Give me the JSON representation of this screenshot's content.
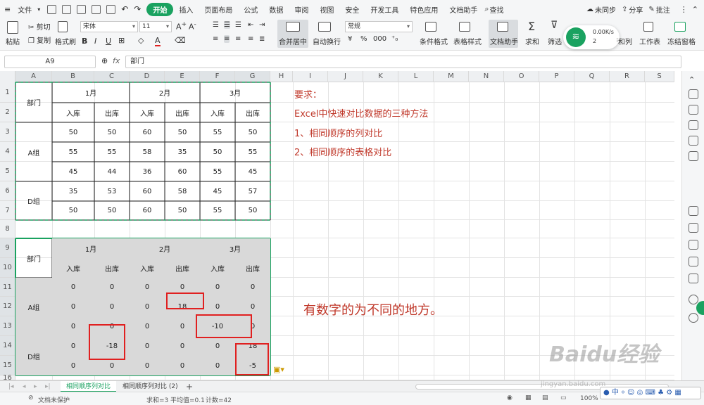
{
  "menu": {
    "file": "文件",
    "tabs": [
      "开始",
      "插入",
      "页面布局",
      "公式",
      "数据",
      "审阅",
      "视图",
      "安全",
      "开发工具",
      "特色应用",
      "文档助手"
    ],
    "search": "查找",
    "right": [
      "未同步",
      "分享",
      "批注"
    ]
  },
  "ribbon": {
    "paste": "粘贴",
    "cut": "剪切",
    "copy": "复制",
    "format_painter": "格式刷",
    "font_name": "宋体",
    "font_size": "11",
    "merge_center": "合并居中",
    "wrap": "自动换行",
    "number_format": "常规",
    "cond_format": "条件格式",
    "table_style": "表格样式",
    "doc_helper": "文档助手",
    "sum": "求和",
    "filter": "筛选",
    "row_col": "行和列",
    "sheet": "工作表",
    "freeze": "冻结窗格",
    "net_speed": "0.00K/s",
    "net_count": "2"
  },
  "formula_bar": {
    "name_box": "A9",
    "fx": "fx",
    "content": "部门"
  },
  "columns": [
    "A",
    "B",
    "C",
    "D",
    "E",
    "F",
    "G",
    "H",
    "I",
    "J",
    "K",
    "L",
    "M",
    "N",
    "O",
    "P",
    "Q",
    "R",
    "S"
  ],
  "rows": [
    "1",
    "2",
    "3",
    "4",
    "5",
    "6",
    "7",
    "8",
    "9",
    "10",
    "11",
    "12",
    "13",
    "14",
    "15",
    "16"
  ],
  "table1": {
    "dept": "部门",
    "months": [
      "1月",
      "2月",
      "3月"
    ],
    "sub": [
      "入库",
      "出库",
      "入库",
      "出库",
      "入库",
      "出库"
    ],
    "groups": [
      "A组",
      "D组"
    ],
    "data": [
      [
        "50",
        "50",
        "60",
        "50",
        "55",
        "50"
      ],
      [
        "55",
        "55",
        "58",
        "35",
        "50",
        "55"
      ],
      [
        "45",
        "44",
        "36",
        "60",
        "55",
        "45"
      ],
      [
        "35",
        "53",
        "60",
        "58",
        "45",
        "57"
      ],
      [
        "50",
        "50",
        "60",
        "50",
        "55",
        "50"
      ]
    ]
  },
  "table2": {
    "dept": "部门",
    "months": [
      "1月",
      "2月",
      "3月"
    ],
    "sub": [
      "入库",
      "出库",
      "入库",
      "出库",
      "入库",
      "出库"
    ],
    "groups": [
      "A组",
      "D组"
    ],
    "data": [
      [
        "0",
        "0",
        "0",
        "0",
        "0",
        "0"
      ],
      [
        "0",
        "0",
        "0",
        "18",
        "0",
        "0"
      ],
      [
        "0",
        "0",
        "0",
        "0",
        "-10",
        "0"
      ],
      [
        "0",
        "-18",
        "0",
        "0",
        "0",
        "18"
      ],
      [
        "0",
        "0",
        "0",
        "0",
        "0",
        "-5"
      ]
    ]
  },
  "notes": {
    "req": "要求：",
    "l1": "Excel中快速对比数据的三种方法",
    "l2": "1、相同顺序的列对比",
    "l3": "2、相同顺序的表格对比",
    "big": "有数字的为不同的地方。"
  },
  "sheet_tabs": [
    "相同顺序列对比",
    "相同顺序列对比 (2)"
  ],
  "status": {
    "protect": "文档未保护",
    "sum": "求和=3",
    "avg": "平均值=0.1",
    "count": "计数=42",
    "zoom": "100%"
  },
  "watermark": "Baidu经验",
  "watermark_url": "jingyan.baidu.com"
}
